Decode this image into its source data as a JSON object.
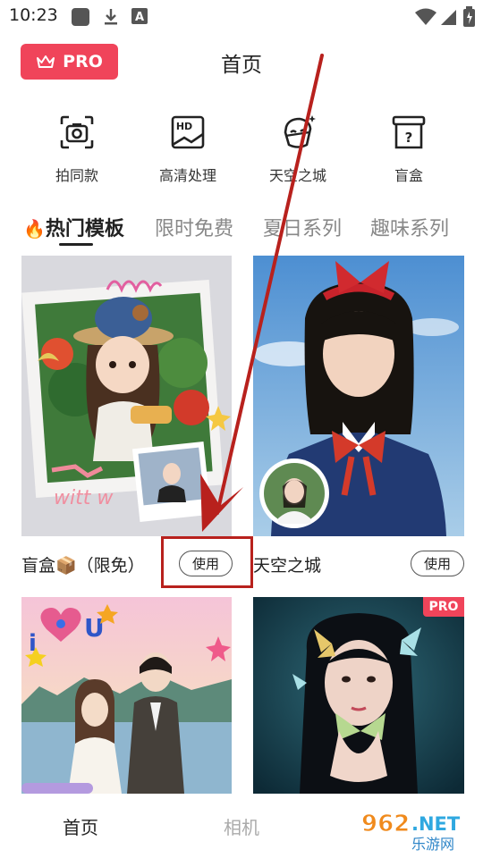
{
  "status_bar": {
    "time": "10:23",
    "icons": [
      "app-square-icon",
      "download-icon",
      "font-a-icon",
      "wifi-icon",
      "signal-icon",
      "battery-icon"
    ]
  },
  "header": {
    "pro_label": "PRO",
    "title": "首页"
  },
  "quick_actions": [
    {
      "label": "拍同款",
      "icon": "camera-icon"
    },
    {
      "label": "高清处理",
      "icon": "hd-icon"
    },
    {
      "label": "天空之城",
      "icon": "mask-face-icon"
    },
    {
      "label": "盲盒",
      "icon": "mystery-box-icon"
    }
  ],
  "tabs": [
    {
      "label": "热门模板",
      "active": true
    },
    {
      "label": "限时免费",
      "active": false
    },
    {
      "label": "夏日系列",
      "active": false
    },
    {
      "label": "趣味系列",
      "active": false
    }
  ],
  "cards": [
    {
      "title": "盲盒📦（限免）",
      "button": "使用"
    },
    {
      "title": "天空之城",
      "button": "使用"
    },
    {
      "title": "",
      "button": ""
    },
    {
      "title": "",
      "button": "",
      "badge": "PRO"
    }
  ],
  "bottom_nav": {
    "home": "首页",
    "camera": "相机"
  },
  "watermark": {
    "number": "962",
    "domain": ".NET",
    "sub": "乐游网"
  },
  "colors": {
    "accent": "#f0445a",
    "annotation": "#b8211d"
  }
}
